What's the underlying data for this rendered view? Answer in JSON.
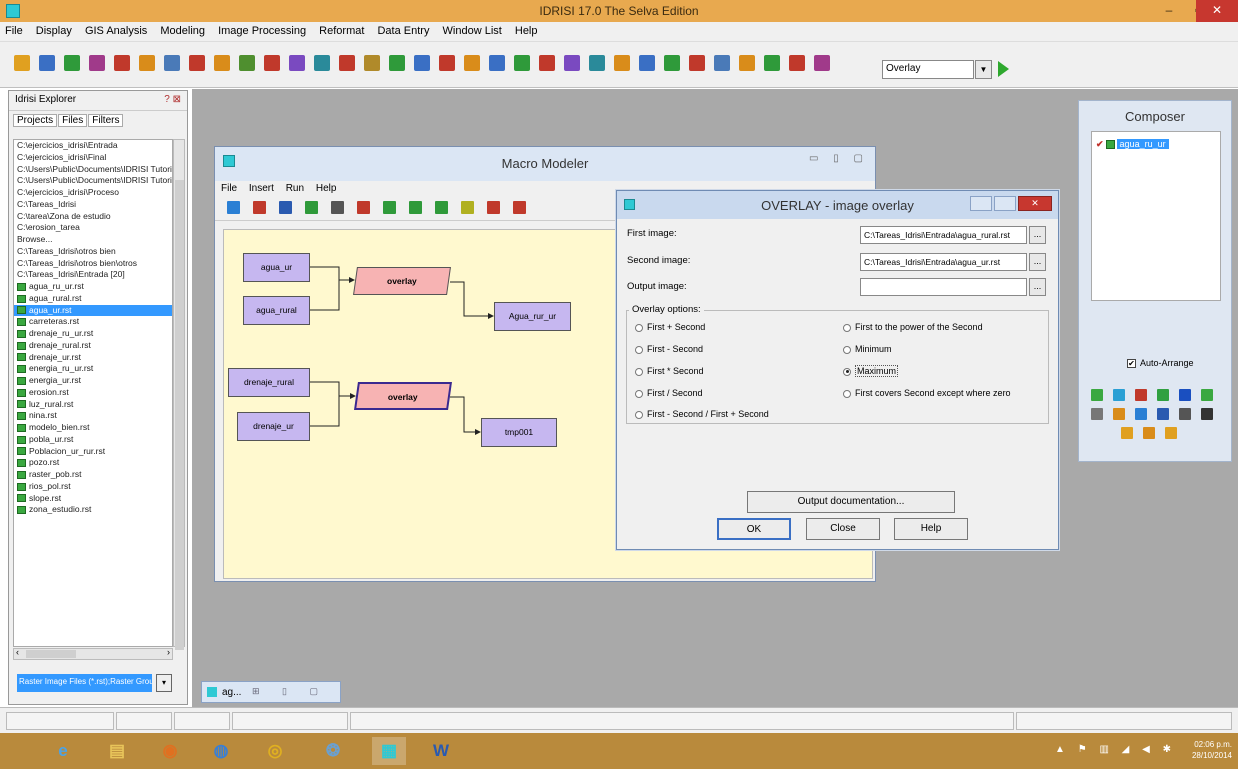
{
  "app": {
    "title": "IDRISI 17.0    The Selva Edition",
    "controls": {
      "minimize": "–",
      "maximize": "▫",
      "close": "✕"
    }
  },
  "menubar": [
    "File",
    "Display",
    "GIS Analysis",
    "Modeling",
    "Image Processing",
    "Reformat",
    "Data Entry",
    "Window List",
    "Help"
  ],
  "toolbar": {
    "module_combo": "Overlay",
    "icon_colors": [
      "#e0a020",
      "#3a6fc4",
      "#2f9a3a",
      "#a03a8a",
      "#c0392b",
      "#d98c1a",
      "#4a7ab8",
      "#c0392b",
      "#d98c1a",
      "#4f8f2f",
      "#c0392b",
      "#7a4ac0",
      "#2a8a9a",
      "#c0392b",
      "#b08a2a",
      "#2f9a3a",
      "#3a6fc4",
      "#c0392b",
      "#d98c1a",
      "#3a6fc4",
      "#2f9a3a",
      "#c0392b",
      "#7a4ac0",
      "#2a8a9a",
      "#d98c1a",
      "#3a6fc4",
      "#2f9a3a",
      "#c0392b",
      "#4a7ab8",
      "#d98c1a",
      "#2f9a3a",
      "#c0392b",
      "#a03a8a"
    ]
  },
  "explorer": {
    "title": "Idrisi Explorer",
    "header_buttons": "? ⊠",
    "tabs": [
      "Projects",
      "Files",
      "Filters"
    ],
    "files": [
      {
        "name": "C:\\ejercicios_idrisi\\Entrada",
        "type": "folder"
      },
      {
        "name": "C:\\ejercicios_idrisi\\Final",
        "type": "folder"
      },
      {
        "name": "C:\\Users\\Public\\Documents\\IDRISI Tutorial Data",
        "type": "folder"
      },
      {
        "name": "C:\\Users\\Public\\Documents\\IDRISI Tutorial Data",
        "type": "folder"
      },
      {
        "name": "C:\\ejercicios_idrisi\\Proceso",
        "type": "folder"
      },
      {
        "name": "C:\\Tareas_Idrisi",
        "type": "folder"
      },
      {
        "name": "C:\\tarea\\Zona de estudio",
        "type": "folder"
      },
      {
        "name": "C:\\erosion_tarea",
        "type": "folder"
      },
      {
        "name": "Browse...",
        "type": "folder"
      },
      {
        "name": "C:\\Tareas_Idrisi\\otros bien",
        "type": "folder"
      },
      {
        "name": "C:\\Tareas_Idrisi\\otros bien\\otros",
        "type": "folder"
      },
      {
        "name": "C:\\Tareas_Idrisi\\Entrada [20]",
        "type": "folder"
      },
      {
        "name": "agua_ru_ur.rst",
        "type": "raster"
      },
      {
        "name": "agua_rural.rst",
        "type": "raster"
      },
      {
        "name": "agua_ur.rst",
        "type": "raster",
        "selected": true
      },
      {
        "name": "carreteras.rst",
        "type": "raster"
      },
      {
        "name": "drenaje_ru_ur.rst",
        "type": "raster"
      },
      {
        "name": "drenaje_rural.rst",
        "type": "raster"
      },
      {
        "name": "drenaje_ur.rst",
        "type": "raster"
      },
      {
        "name": "energia_ru_ur.rst",
        "type": "raster"
      },
      {
        "name": "energia_ur.rst",
        "type": "raster"
      },
      {
        "name": "erosion.rst",
        "type": "raster"
      },
      {
        "name": "luz_rural.rst",
        "type": "raster"
      },
      {
        "name": "nina.rst",
        "type": "raster"
      },
      {
        "name": "modelo_bien.rst",
        "type": "raster"
      },
      {
        "name": "pobla_ur.rst",
        "type": "raster"
      },
      {
        "name": "Poblacion_ur_rur.rst",
        "type": "raster"
      },
      {
        "name": "pozo.rst",
        "type": "raster"
      },
      {
        "name": "raster_pob.rst",
        "type": "raster"
      },
      {
        "name": "rios_pol.rst",
        "type": "raster"
      },
      {
        "name": "slope.rst",
        "type": "raster"
      },
      {
        "name": "zona_estudio.rst",
        "type": "raster"
      }
    ],
    "filter_value": "Raster Image Files (*.rst);Raster Group Files (*.rgf)",
    "filter_dropdown": "▾",
    "hscroll_left": "‹",
    "hscroll_right": "›"
  },
  "macro_modeler": {
    "title": "Macro Modeler",
    "window_buttons": "▭ ▯ ▢",
    "menu": [
      "File",
      "Insert",
      "Run",
      "Help"
    ],
    "tool_colors": [
      "#2a7fd4",
      "#c0392b",
      "#2a5ab0",
      "#2f9a3a",
      "#555555",
      "#c0392b",
      "#2f9a3a",
      "#2f9a3a",
      "#2f9a3a",
      "#b0b020",
      "#c0392b",
      "#c0392b"
    ],
    "nodes": [
      {
        "label": "agua_ur",
        "kind": "raster"
      },
      {
        "label": "agua_rural",
        "kind": "raster"
      },
      {
        "label": "overlay",
        "kind": "op"
      },
      {
        "label": "Agua_rur_ur",
        "kind": "raster"
      },
      {
        "label": "drenaje_rural",
        "kind": "raster"
      },
      {
        "label": "drenaje_ur",
        "kind": "raster"
      },
      {
        "label": "overlay",
        "kind": "op"
      },
      {
        "label": "tmp001",
        "kind": "raster"
      }
    ]
  },
  "overlay_dialog": {
    "title": "OVERLAY - image overlay",
    "close_glyph": "✕",
    "first_image_label": "First image:",
    "first_image_value": "C:\\Tareas_Idrisi\\Entrada\\agua_rural.rst",
    "second_image_label": "Second image:",
    "second_image_value": "C:\\Tareas_Idrisi\\Entrada\\agua_ur.rst",
    "output_image_label": "Output image:",
    "output_image_value": "",
    "browse_label": "...",
    "options_title": "Overlay options:",
    "options": [
      {
        "label": "First + Second",
        "checked": false
      },
      {
        "label": "First - Second",
        "checked": false
      },
      {
        "label": "First * Second",
        "checked": false
      },
      {
        "label": "First / Second",
        "checked": false
      },
      {
        "label": "First - Second / First + Second",
        "checked": false
      },
      {
        "label": "First to the power of the Second",
        "checked": false
      },
      {
        "label": "Minimum",
        "checked": false
      },
      {
        "label": "Maximum",
        "checked": true
      },
      {
        "label": "First covers Second except where zero",
        "checked": false
      }
    ],
    "output_doc_button": "Output documentation...",
    "ok_button": "OK",
    "close_button": "Close",
    "help_button": "Help"
  },
  "composer": {
    "title": "Composer",
    "layer_check": "✔",
    "layer_name": "agua_ru_ur",
    "auto_arrange_label": "Auto-Arrange",
    "auto_arrange_mark": "✔",
    "auto_arrange_checked": true,
    "tool_colors": [
      "#3aa840",
      "#2a9fd4",
      "#c0392b",
      "#2fa040",
      "#1a4fc0",
      "#3aa840",
      "#777777",
      "#d98c1a",
      "#2a7fd4",
      "#2a5ab0",
      "#555555",
      "#333333",
      "#e0a020",
      "#d98c1a",
      "#e0a020"
    ]
  },
  "minimized_window": {
    "title": "ag...",
    "buttons": "⊞ ▯ ▢"
  },
  "taskbar": {
    "apps": [
      {
        "name": "internet-explorer",
        "glyph": "e",
        "color": "#4aa3e8"
      },
      {
        "name": "file-explorer",
        "glyph": "▤",
        "color": "#e8c45a"
      },
      {
        "name": "firefox",
        "glyph": "◉",
        "color": "#e07020"
      },
      {
        "name": "network",
        "glyph": "◍",
        "color": "#3a7fd4"
      },
      {
        "name": "chrome",
        "glyph": "◎",
        "color": "#e0b020"
      },
      {
        "name": "globe",
        "glyph": "❂",
        "color": "#6aa0d0"
      },
      {
        "name": "idrisi",
        "glyph": "▦",
        "color": "#2ec9d4"
      },
      {
        "name": "word",
        "glyph": "W",
        "color": "#2a5ab0"
      }
    ],
    "tray": "▲ ⚑ ▥ ◢ ◀ ✱",
    "clock_time": "02:06 p.m.",
    "clock_date": "28/10/2014"
  }
}
